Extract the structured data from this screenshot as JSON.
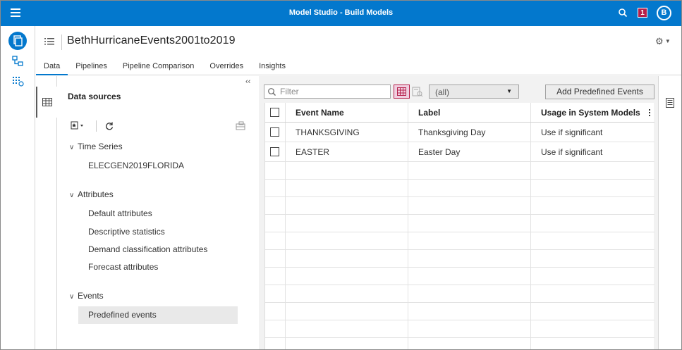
{
  "app": {
    "title": "Model Studio - Build Models",
    "notification_count": "1",
    "user_initial": "B"
  },
  "project": {
    "title": "BethHurricaneEvents2001to2019"
  },
  "tabs": [
    {
      "label": "Data",
      "active": true
    },
    {
      "label": "Pipelines"
    },
    {
      "label": "Pipeline Comparison"
    },
    {
      "label": "Overrides"
    },
    {
      "label": "Insights"
    }
  ],
  "data_sources": {
    "heading": "Data sources",
    "collapse_glyph": "‹‹",
    "groups": [
      {
        "label": "Time Series",
        "items": [
          "ELECGEN2019FLORIDA"
        ]
      },
      {
        "label": "Attributes",
        "items": [
          "Default attributes",
          "Descriptive statistics",
          "Demand classification attributes",
          "Forecast attributes"
        ]
      },
      {
        "label": "Events",
        "items": [
          "Predefined events"
        ]
      }
    ],
    "selected": "Predefined events"
  },
  "toolbar": {
    "filter_placeholder": "Filter",
    "select_value": "(all)",
    "add_button": "Add Predefined Events"
  },
  "table": {
    "columns": [
      "Event Name",
      "Label",
      "Usage in System Models"
    ],
    "rows": [
      [
        "THANKSGIVING",
        "Thanksgiving Day",
        "Use if significant"
      ],
      [
        "EASTER",
        "Easter Day",
        "Use if significant"
      ]
    ]
  },
  "icons": {
    "menu": "hamburger-icon",
    "search": "search-icon",
    "settings": "gear-icon",
    "list": "list-icon",
    "table_view": "grid-icon",
    "refresh": "refresh-icon"
  },
  "colors": {
    "brand": "#0378cd",
    "badge": "#b6204b",
    "selected_view": "#f0cfe0"
  }
}
